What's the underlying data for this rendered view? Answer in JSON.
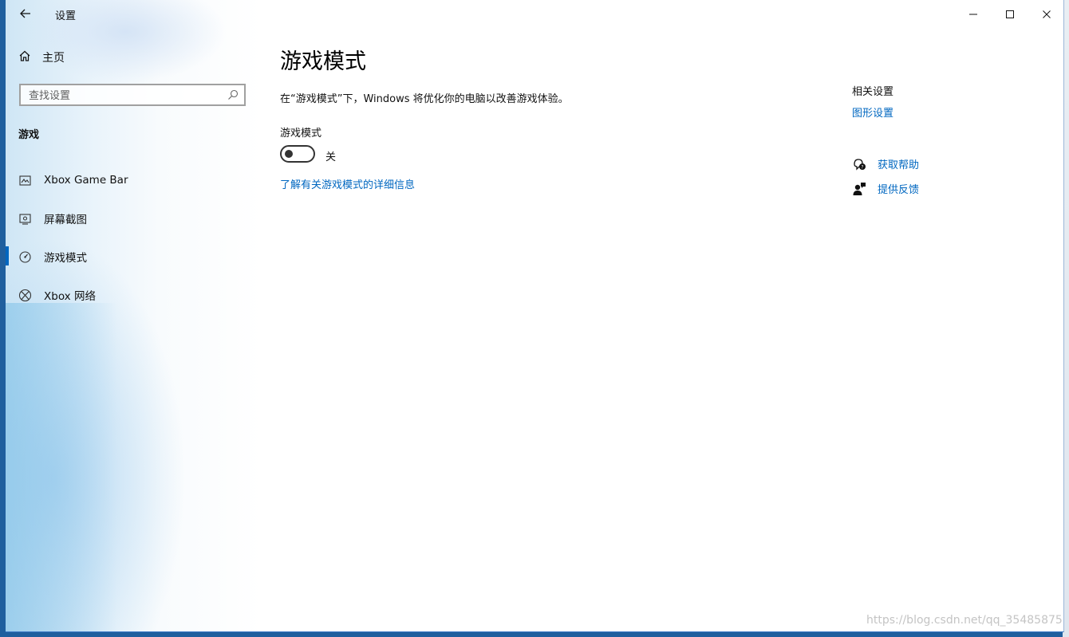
{
  "window": {
    "title": "设置"
  },
  "sidebar": {
    "home_label": "主页",
    "search_placeholder": "查找设置",
    "section_title": "游戏",
    "items": [
      {
        "label": "Xbox Game Bar",
        "icon": "game-bar-icon"
      },
      {
        "label": "屏幕截图",
        "icon": "screenshot-icon"
      },
      {
        "label": "游戏模式",
        "icon": "game-mode-icon",
        "selected": true
      },
      {
        "label": "Xbox 网络",
        "icon": "xbox-icon"
      }
    ]
  },
  "main": {
    "title": "游戏模式",
    "description": "在“游戏模式”下，Windows 将优化你的电脑以改善游戏体验。",
    "toggle_label": "游戏模式",
    "toggle_state": "关",
    "toggle_on": false,
    "learn_more": "了解有关游戏模式的详细信息"
  },
  "related": {
    "title": "相关设置",
    "graphics_link": "图形设置",
    "get_help": "获取帮助",
    "feedback": "提供反馈"
  },
  "watermark": "https://blog.csdn.net/qq_35485875",
  "colors": {
    "accent": "#0067c0"
  }
}
